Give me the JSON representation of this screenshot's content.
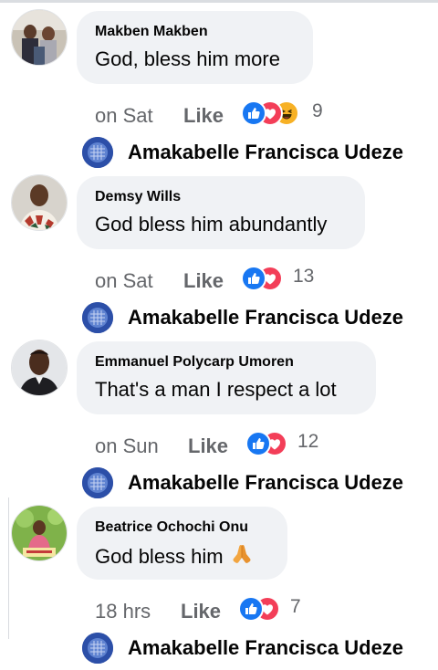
{
  "comments": [
    {
      "author": "Makben Makben",
      "text": "God, bless him more",
      "time": "on Sat",
      "like_label": "Like",
      "reaction_count": "9",
      "reply_name": "Amakabelle Francisca Udeze"
    },
    {
      "author": "Demsy Wills",
      "text": "God bless him abundantly",
      "time": "on Sat",
      "like_label": "Like",
      "reaction_count": "13",
      "reply_name": "Amakabelle Francisca Udeze"
    },
    {
      "author": "Emmanuel Polycarp Umoren",
      "text": "That's a man I respect a lot",
      "time": "on Sun",
      "like_label": "Like",
      "reaction_count": "12",
      "reply_name": "Amakabelle Francisca Udeze"
    },
    {
      "author": "Beatrice Ochochi Onu",
      "text": "God bless him",
      "time": "18 hrs",
      "like_label": "Like",
      "reaction_count": "7",
      "reply_name": "Amakabelle Francisca Udeze"
    }
  ],
  "icons": {
    "like": "like-reaction-icon",
    "love": "love-reaction-icon",
    "haha": "haha-reaction-icon",
    "pray": "folded-hands-emoji"
  },
  "colors": {
    "bubble": "#f0f2f5",
    "meta_text": "#65676b",
    "like_blue": "#1877f2",
    "love_red": "#f33e58",
    "haha_yellow": "#f7b125"
  }
}
